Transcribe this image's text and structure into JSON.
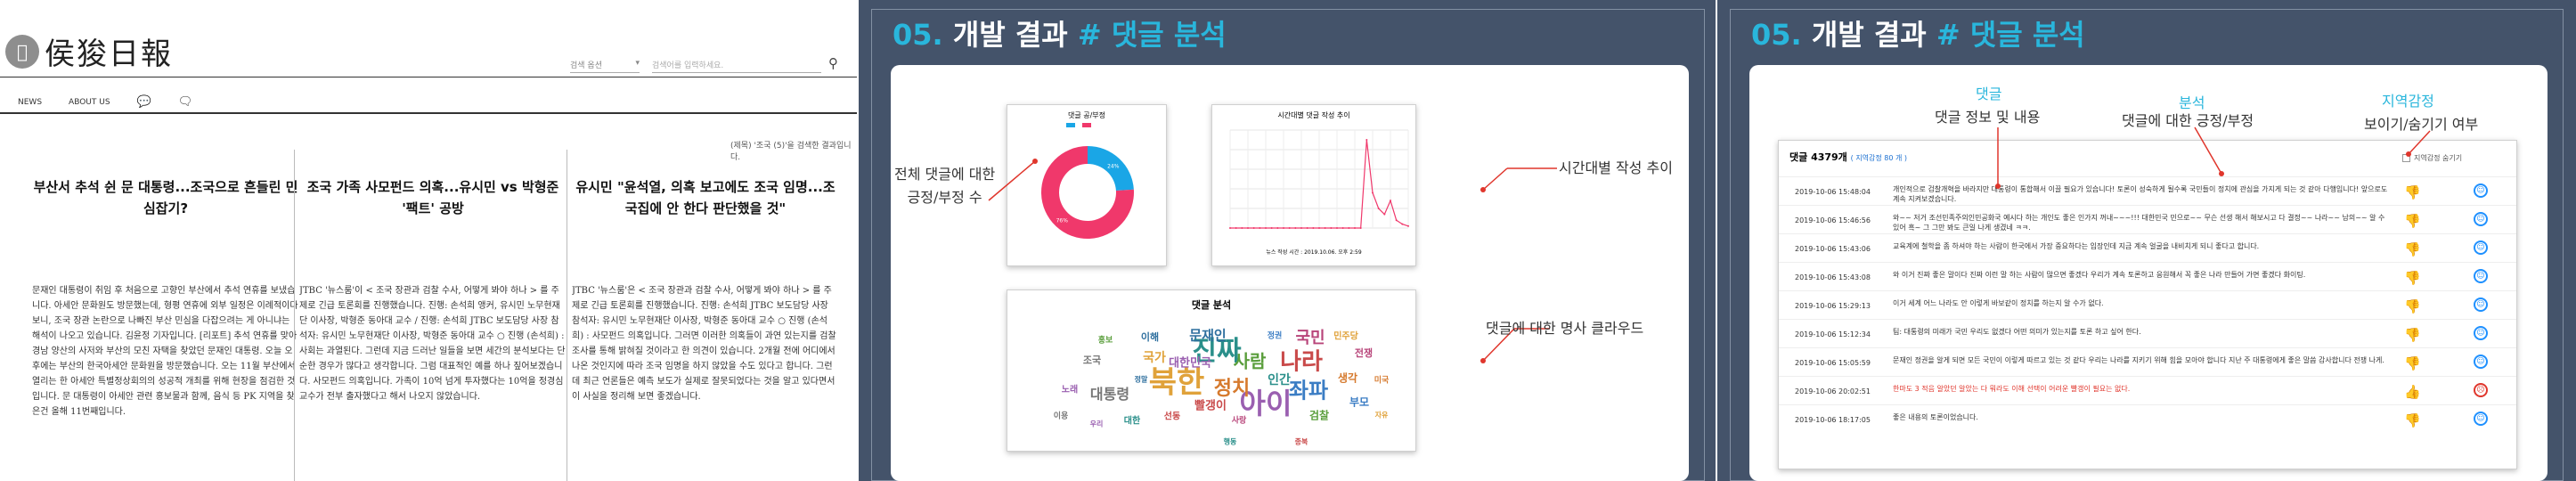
{
  "panel1": {
    "logo_text": "",
    "site_title": "侯狻日報",
    "search_select": "검색 옵션",
    "search_placeholder": "검색어를 입력하세요.",
    "nav": [
      "NEWS",
      "ABOUT US"
    ],
    "result_text": "(제목) '조국 (5)'을 검색한 결과입니다.",
    "articles": [
      {
        "headline": "부산서 추석 쉰 문 대통령...조국으로 흔들린 민심잡기?",
        "body": "문재인 대통령이 취임 후 처음으로 고향인 부산에서 추석 연휴를 보냈습니다. 아세안 문화원도 방문했는데, 형평 연휴에 외부 일정은 이례적이다보니, 조국 장관 논란으로 나빠진 부산 민심을 다잡으려는 게 아니냐는 해석이 나오고 있습니다. 김윤정 기자입니다. [리포트] 추석 연휴를 맞아 경남 양산의 사저와 부산의 모친 자택을 찾았던 문재인 대통령. 오늘 오후에는 부산의 한국아세안 문화원을 방문했습니다. 오는 11월 부산에서 열리는 한 아세안 특별정상회의의 성공적 개최를 위해 현장을 점검한 것입니다. 문 대통령이 아세안 관련 홍보물과 함께, 음식 등 PK 지역을 찾은건 올해 11번째입니다."
      },
      {
        "headline": "조국 가족 사모펀드 의혹...유시민 vs 박형준 '팩트' 공방",
        "body": "JTBC '뉴스룸'이 < 조국 장관과 검찰 수사, 어떻게 봐야 하나 > 를 주제로 긴급 토론회를 진행했습니다. 진행: 손석희 앵커, 유시민 노무현재단 이사장, 박형준 동아대 교수 / 진행: 손석희 JTBC 보도담당 사장 참석자: 유시민 노무현재단 이사장, 박형준 동아대 교수 ○ 진행 (손석희) : 사회는 과열된다. 그런데 지금 드러난 일들을 보면 세간의 분석보다는 단순한 경우가 많다고 생각합니다. 그럼 대표적인 예를 하나 짚어보겠습니다. 사모펀드 의혹입니다. 가족이 10억 넘게 투자했다는 10억을 정경심 교수가 전부 출자했다고 해서 나오지 않았습니다."
      },
      {
        "headline": "유시민 \"윤석열, 의혹 보고에도 조국 임명...조국집에 안 한다 판단했을 것\"",
        "body": "JTBC '뉴스룸'은 < 조국 장관과 검찰 수사, 어떻게 봐야 하나 > 를 주제로 긴급 토론회를 진행했습니다. 진행: 손석희 JTBC 보도담당 사장 참석자: 유시민 노무현재단 이사장, 박형준 동아대 교수 ○ 진행 (손석희) : 사모펀드 의혹입니다. 그러면 이러한 의혹들이 과연 있는지를 검찰 조사를 통해 밝혀질 것이라고 한 의견이 있습니다. 2개월 전에 어디에서 나온 것인지에 따라 조국 임명을 하지 않았을 수도 있다고 합니다. 그런데 최근 언론들은 예측 보도가 실제로 잘못되었다는 것을 알고 있다면서 이 사실을 정리해 보면 좋겠습니다."
      }
    ]
  },
  "panel2": {
    "title_num": "05.",
    "title_main": "개발 결과",
    "title_hash": "# 댓글 분석",
    "donut_title": "댓글 공/부정",
    "line_title": "시간대별 댓글 작성 추이",
    "line_caption": "뉴스 작성 시간 : 2019.10.06. 오후 2:59",
    "cloud_title": "댓글 분석",
    "anno_left": "전체 댓글에 대한\n긍정/부정 수",
    "anno_right_top": "시간대별 작성 추이",
    "anno_right_bottom": "댓글에 대한 명사 클라우드",
    "cloud_words": [
      "북한",
      "진짜",
      "아이",
      "나라",
      "좌파",
      "정치",
      "사람",
      "국민",
      "대통령",
      "문재인",
      "국가",
      "인간",
      "대한민국",
      "빨갱이",
      "부모",
      "생각",
      "검찰",
      "전쟁",
      "조국",
      "이해",
      "민주당",
      "대한",
      "노래",
      "선동",
      "정권",
      "미국",
      "홍보",
      "사랑",
      "이용",
      "정말",
      "자유",
      "행동",
      "우리",
      "종북"
    ]
  },
  "chart_data": [
    {
      "type": "pie",
      "title": "댓글 공/부정",
      "categories": [
        "긍정",
        "부정"
      ],
      "values": [
        24,
        76
      ],
      "colors": [
        "#1aa6e6",
        "#f0386b"
      ],
      "data_labels": [
        "24%",
        "76%"
      ]
    },
    {
      "type": "line",
      "title": "시간대별 댓글 작성 추이",
      "x": [
        0,
        1,
        2,
        3,
        4,
        5,
        6,
        7,
        8,
        9,
        10,
        11,
        12,
        13,
        14,
        15,
        16,
        17,
        18,
        19,
        20,
        21,
        22,
        23,
        24,
        25,
        26,
        27,
        28,
        29,
        30
      ],
      "values": [
        0,
        0,
        0,
        0,
        0,
        0,
        0,
        0,
        0,
        0,
        0,
        0,
        0,
        0,
        0,
        0,
        0,
        0,
        0,
        0,
        0,
        0,
        0,
        45,
        18,
        10,
        7,
        14,
        4,
        2,
        1
      ],
      "series": [
        {
          "name": "댓글",
          "values": [
            0,
            0,
            0,
            0,
            0,
            0,
            0,
            0,
            0,
            0,
            0,
            0,
            0,
            0,
            0,
            0,
            0,
            0,
            0,
            0,
            0,
            0,
            0,
            45,
            18,
            10,
            7,
            14,
            4,
            2,
            1
          ]
        }
      ],
      "color": "#f0386b",
      "ylim": [
        0,
        50
      ],
      "grid": true
    }
  ],
  "panel3": {
    "title_num": "05.",
    "title_main": "개발 결과",
    "title_hash": "# 댓글 분석",
    "h_label1": "댓글",
    "h_label1_sub": "댓글 정보 및 내용",
    "h_label2": "분석",
    "h_label2_sub": "댓글에 대한 긍정/부정",
    "h_label3": "지역감정",
    "h_label3_sub": "보이기/숨기기 여부",
    "count_label": "댓글 4379개",
    "count_sub": "( 지역감정 80 개 )",
    "toggle_label": "지역감정 숨기기",
    "rows": [
      {
        "date": "2019-10-06 15:48:04",
        "text": "개인적으로 검찰개혁을 바라지만 대통령이 통합해서 이끌 필요가 있습니다! 토론이 성숙하게 될수록 국민들이 정치에 관심을 가지게 되는 것 같아 다행입니다! 앞으로도 계속 지켜보겠습니다.",
        "thumb": "down",
        "smile": "happy",
        "red": false
      },
      {
        "date": "2019-10-06 15:46:56",
        "text": "와~~ 저거 조선민족주의인민공화국 예시다 하는 개인도 좋은 인가지 꺼내~~~!!! 대한민국 민으로~~ 무슨 선생 해서 해보시고 다 결정~~ 나라~~ 남의~~ 알 수 있어 흑~ 그 그만 봐도 큰일 나게 생겼네 ㅋㅋ.",
        "thumb": "down",
        "smile": "happy",
        "red": false
      },
      {
        "date": "2019-10-06 15:43:06",
        "text": "교육계에 철학을 좀 하셔야 하는 사람이 한국에서 가장 중요하다는 입장인데 지금 계속 얼굴을 내비치게 되니 좋다고 합니다.",
        "thumb": "down",
        "smile": "happy",
        "red": false
      },
      {
        "date": "2019-10-06 15:43:08",
        "text": "와 이거 진짜 좋은 말이다 진짜 이런 말 하는 사람이 많으면 좋겠다 우리가 계속 토론하고 응원해서 꼭 좋은 나라 만들어 가면 좋겠다 화이팅.",
        "thumb": "down",
        "smile": "happy",
        "red": false
      },
      {
        "date": "2019-10-06 15:29:13",
        "text": "이거 세계 어느 나라도 안 이렇게 바보같이 정치를 하는지 알 수가 없다.",
        "thumb": "down",
        "smile": "happy",
        "red": false
      },
      {
        "date": "2019-10-06 15:12:34",
        "text": "팀: 대통령의 미래가 국민 우리도 없겠다 어떤 의미가 있는지를 토론 하고 싶어 한다.",
        "thumb": "down",
        "smile": "happy",
        "red": false
      },
      {
        "date": "2019-10-06 15:05:59",
        "text": "문재인 정권을 알게 되면 모든 국민이 이렇게 따르고 있는 것 같다 우리는 나라를 지키기 위해 힘을 모아야 합니다 지난 주 대통령에게 좋은 말씀 감사합니다 전쟁 나게.",
        "thumb": "down",
        "smile": "happy",
        "red": false
      },
      {
        "date": "2019-10-06 20:02:51",
        "text": "한마도 3 적음 알았던 알았는 다 뭐라도 이해 선택이 어려운 빨갱이 필요는 없다.",
        "thumb": "up",
        "smile": "sad",
        "red": true
      },
      {
        "date": "2019-10-06 18:17:05",
        "text": "좋은 내용의 토론이었습니다.",
        "thumb": "down",
        "smile": "happy",
        "red": false
      }
    ]
  }
}
